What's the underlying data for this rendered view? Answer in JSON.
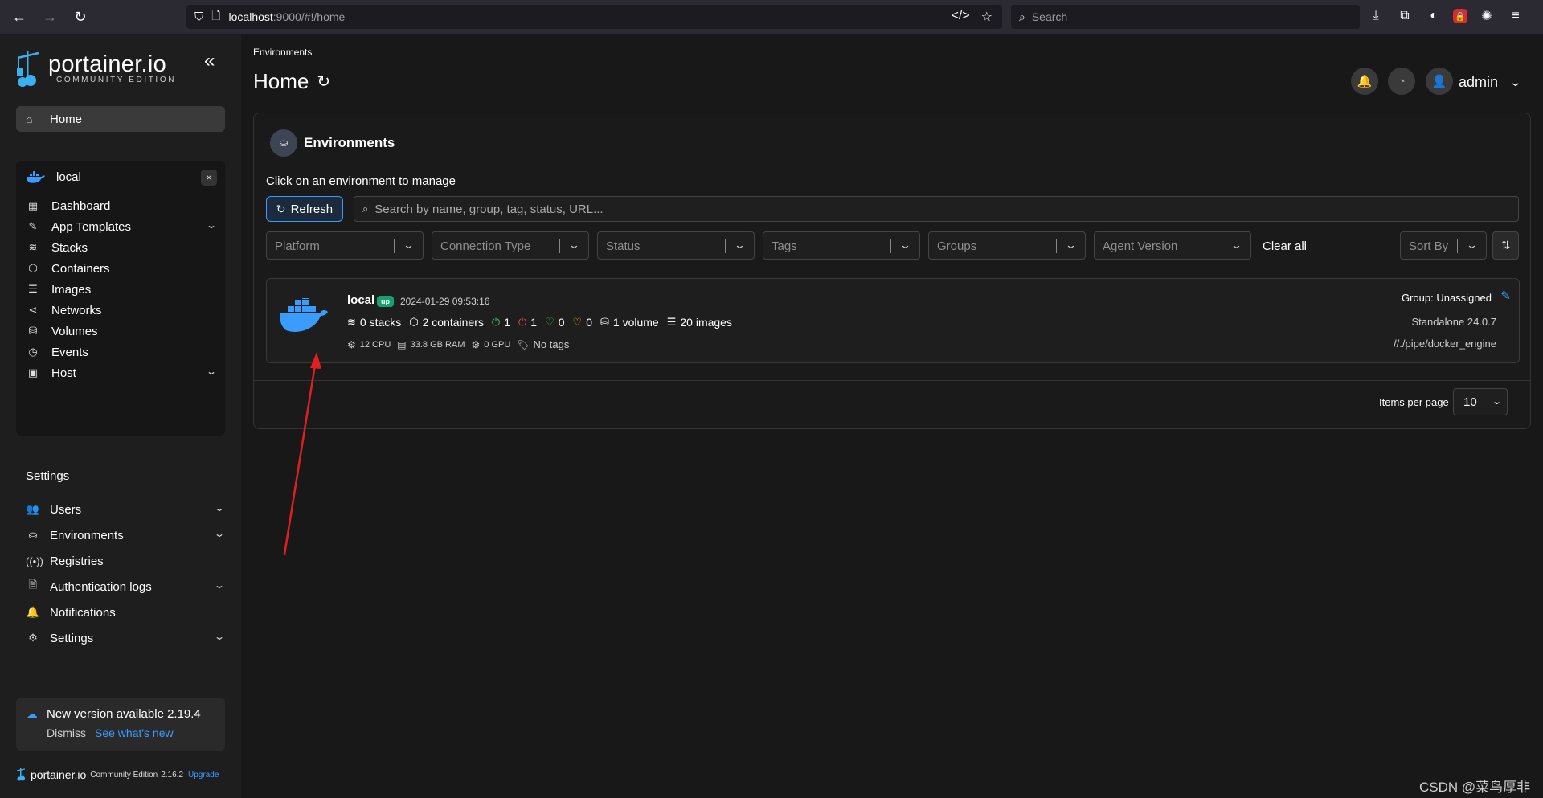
{
  "browser": {
    "url_host": "localhost",
    "url_rest": ":9000/#!/home",
    "search_placeholder": "Search"
  },
  "sidebar": {
    "brand": "portainer.io",
    "edition": "COMMUNITY EDITION",
    "home_label": "Home",
    "environment": {
      "name": "local",
      "close": "×",
      "items": [
        {
          "label": "Dashboard",
          "icon": "dashboard-icon"
        },
        {
          "label": "App Templates",
          "icon": "edit-icon"
        },
        {
          "label": "Stacks",
          "icon": "layers-icon"
        },
        {
          "label": "Containers",
          "icon": "box-icon"
        },
        {
          "label": "Images",
          "icon": "list-icon"
        },
        {
          "label": "Networks",
          "icon": "share-icon"
        },
        {
          "label": "Volumes",
          "icon": "database-icon"
        },
        {
          "label": "Events",
          "icon": "clock-icon"
        },
        {
          "label": "Host",
          "icon": "server-icon"
        }
      ]
    },
    "settings_heading": "Settings",
    "settings_items": [
      {
        "label": "Users"
      },
      {
        "label": "Environments"
      },
      {
        "label": "Registries"
      },
      {
        "label": "Authentication logs"
      },
      {
        "label": "Notifications"
      },
      {
        "label": "Settings"
      }
    ],
    "update": {
      "message": "New version available 2.19.4",
      "dismiss": "Dismiss",
      "see_new": "See what's new"
    },
    "footer": {
      "brand": "portainer.io",
      "edition": "Community Edition",
      "version": "2.16.2",
      "upgrade": "Upgrade"
    }
  },
  "header": {
    "breadcrumb": "Environments",
    "title": "Home",
    "user": "admin"
  },
  "panel": {
    "title": "Environments",
    "subtitle": "Click on an environment to manage",
    "refresh_label": "Refresh",
    "search_placeholder": "Search by name, group, tag, status, URL...",
    "filters": [
      "Platform",
      "Connection Type",
      "Status",
      "Tags",
      "Groups",
      "Agent Version"
    ],
    "clear_all": "Clear all",
    "sort_by": "Sort By",
    "environment_card": {
      "name": "local",
      "status": "up",
      "timestamp": "2024-01-29 09:53:16",
      "stacks": "0 stacks",
      "containers": "2 containers",
      "running": "1",
      "stopped": "1",
      "healthy": "0",
      "unhealthy": "0",
      "volumes": "1 volume",
      "images": "20 images",
      "cpu": "12 CPU",
      "ram": "33.8 GB RAM",
      "gpu": "0 GPU",
      "tags": "No tags",
      "group": "Group: Unassigned",
      "engine": "Standalone 24.0.7",
      "path": "//./pipe/docker_engine"
    },
    "items_per_page_label": "Items per page",
    "items_per_page_value": "10"
  },
  "watermark": "CSDN @菜鸟厚非",
  "colors": {
    "accent": "#3b9cff",
    "up_badge": "#14a36f",
    "annotation_arrow": "#e02020"
  }
}
